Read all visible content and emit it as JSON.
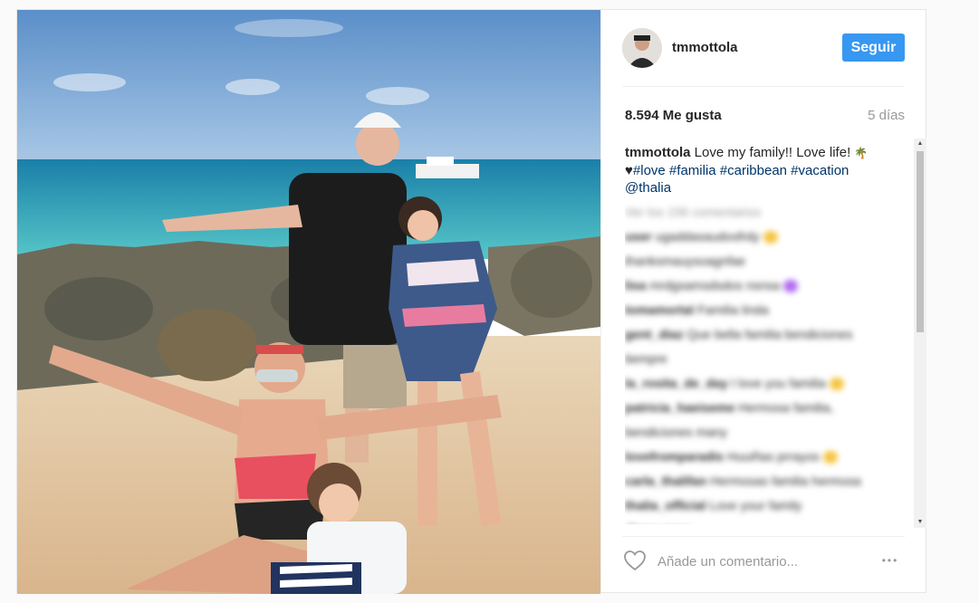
{
  "post": {
    "username": "tmmottola",
    "follow_label": "Seguir",
    "likes": "8.594 Me gusta",
    "time_ago": "5 días",
    "caption_username": "tmmottola",
    "caption_text": "Love my family!! Love life!",
    "hashtags": "#love #familia #caribbean #vacation",
    "mention": "@thalia",
    "comment_placeholder": "Añade un comentario...",
    "more_label": "•••"
  },
  "blurred_comments": [
    {
      "user": "Ver los 156 comentarios",
      "text": ""
    },
    {
      "user": "user",
      "text": "ugaddasaudosfrdy"
    },
    {
      "user": "",
      "text": "thanksmauysoagnfae"
    },
    {
      "user": "lisa",
      "text": "mrdgsamsdsdos nsnsa"
    },
    {
      "user": "tomamortal",
      "text": "Familia linda"
    },
    {
      "user": "gent_diaz",
      "text": "Que bella familia bendiciones"
    },
    {
      "user": "",
      "text": "tiempre"
    },
    {
      "user": "la_rosita_de_day",
      "text": "I love you familia"
    },
    {
      "user": "patricia_haeiseme",
      "text": "Hermosa familia,"
    },
    {
      "user": "",
      "text": "bendiciones many"
    },
    {
      "user": "lovefromparadis",
      "text": "Huuiñas prrayos"
    },
    {
      "user": "carla_thalifan",
      "text": "Hermosas familia hermosa"
    },
    {
      "user": "",
      "text": ""
    },
    {
      "user": "thalia_official",
      "text": "Love your family"
    },
    {
      "user": "",
      "text": "@mauricioo"
    }
  ],
  "icons": {
    "heart": "heart-outline-icon",
    "more": "more-options-icon"
  },
  "colors": {
    "follow_button": "#3897f0",
    "link": "#003569",
    "muted": "#999999"
  }
}
